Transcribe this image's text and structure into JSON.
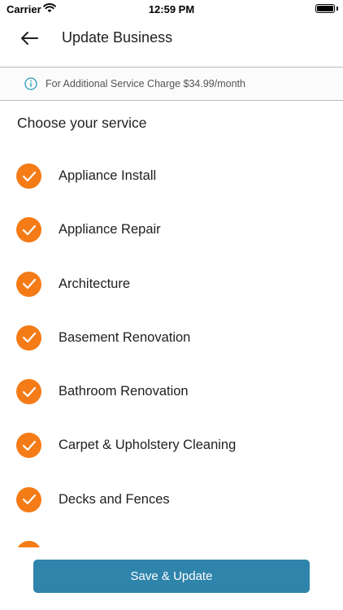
{
  "status_bar": {
    "carrier": "Carrier",
    "time": "12:59 PM",
    "icons": [
      "wifi-icon",
      "battery-icon"
    ]
  },
  "nav": {
    "title": "Update Business",
    "back_icon": "arrow-left-icon"
  },
  "notice": {
    "icon": "info-icon",
    "text": "For Additional Service Charge $34.99/month",
    "accent_color": "#2a9bb8"
  },
  "section_title": "Choose your service",
  "services": [
    {
      "label": "Appliance Install",
      "checked": true
    },
    {
      "label": "Appliance Repair",
      "checked": true
    },
    {
      "label": "Architecture",
      "checked": true
    },
    {
      "label": "Basement Renovation",
      "checked": true
    },
    {
      "label": "Bathroom Renovation",
      "checked": true
    },
    {
      "label": "Carpet & Upholstery Cleaning",
      "checked": true
    },
    {
      "label": "Decks and Fences",
      "checked": true
    },
    {
      "label": "",
      "checked": true
    }
  ],
  "colors": {
    "check": "#f47b16",
    "primary_button": "#2f84ab"
  },
  "save_button": {
    "label": "Save & Update"
  }
}
